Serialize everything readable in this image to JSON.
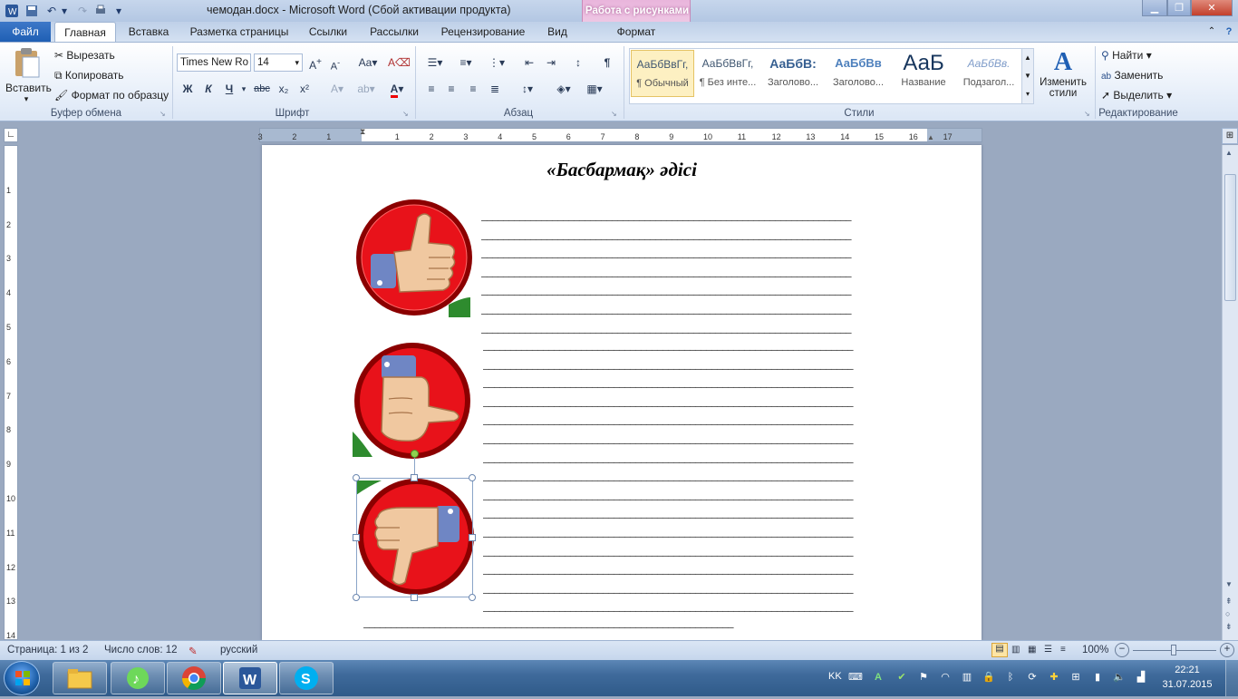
{
  "window": {
    "title": "чемодан.docx  -  Microsoft Word (Сбой активации продукта)",
    "picture_tools": "Работа с рисунками"
  },
  "tabs": [
    "Файл",
    "Главная",
    "Вставка",
    "Разметка страницы",
    "Ссылки",
    "Рассылки",
    "Рецензирование",
    "Вид",
    "Формат"
  ],
  "clipboard": {
    "paste": "Вставить",
    "cut": "Вырезать",
    "copy": "Копировать",
    "format_painter": "Формат по образцу",
    "label": "Буфер обмена"
  },
  "font": {
    "family": "Times New Ro",
    "size": "14",
    "label": "Шрифт",
    "bold": "Ж",
    "italic": "К",
    "underline": "Ч",
    "strike": "abc",
    "sub": "x₂",
    "sup": "x²"
  },
  "paragraph": {
    "label": "Абзац"
  },
  "styles": {
    "label": "Стили",
    "items": [
      {
        "sample": "АаБбВвГг,",
        "name": "¶ Обычный"
      },
      {
        "sample": "АаБбВвГг,",
        "name": "¶ Без инте..."
      },
      {
        "sample": "АаБбВ:",
        "name": "Заголово..."
      },
      {
        "sample": "АаБбВв",
        "name": "Заголово..."
      },
      {
        "sample": "АаБ",
        "name": "Название"
      },
      {
        "sample": "АаБбВв.",
        "name": "Подзагол..."
      }
    ],
    "change": "Изменить стили"
  },
  "editing": {
    "find": "Найти",
    "replace": "Заменить",
    "select": "Выделить",
    "label": "Редактирование"
  },
  "ruler_h": [
    "3",
    "2",
    "1",
    "1",
    "2",
    "3",
    "4",
    "5",
    "6",
    "7",
    "8",
    "9",
    "10",
    "11",
    "12",
    "13",
    "14",
    "15",
    "16",
    "17"
  ],
  "ruler_v": [
    "1",
    "2",
    "3",
    "4",
    "5",
    "6",
    "7",
    "8",
    "9",
    "10",
    "11",
    "12",
    "13",
    "14"
  ],
  "document": {
    "title": "«Басбармақ» әдісі",
    "underline_text": "____________________________________________________________________"
  },
  "status": {
    "page": "Страница: 1 из 2",
    "words": "Число слов: 12",
    "lang": "русский",
    "zoom": "100%"
  },
  "taskbar": {
    "lang": "KK",
    "time": "22:21",
    "date": "31.07.2015"
  },
  "colors": {
    "accent": "#2b579a",
    "ribbon": "#dbe6f5",
    "pictools": "#e9b5dc"
  }
}
